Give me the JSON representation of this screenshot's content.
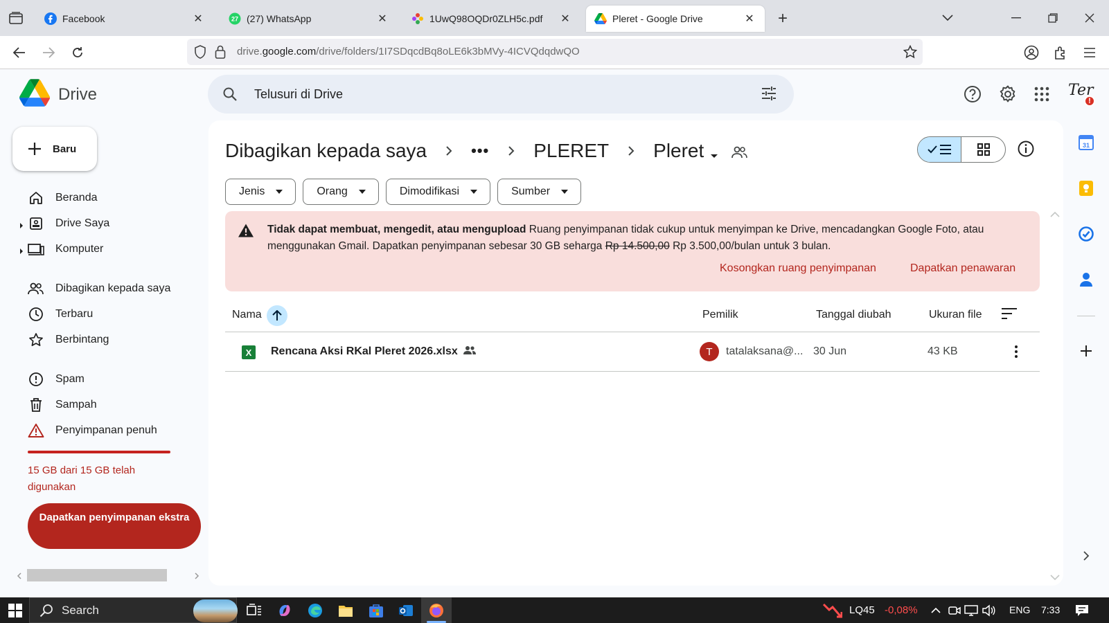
{
  "browser": {
    "tabs": [
      {
        "label": "Facebook",
        "icon": "facebook-icon",
        "active": false
      },
      {
        "label": "(27) WhatsApp",
        "icon": "whatsapp-icon",
        "badge": "27",
        "active": false
      },
      {
        "label": "1UwQ98OQDr0ZLH5c.pdf",
        "icon": "pdf-icon",
        "active": false
      },
      {
        "label": "Pleret - Google Drive",
        "icon": "google-drive-icon",
        "active": true
      }
    ],
    "url_prefix": "drive.",
    "url_host": "google.com",
    "url_path": "/drive/folders/1I7SDqcdBq8oLE6k3bMVy-4ICVQdqdwQO"
  },
  "drive": {
    "logo_text": "Drive",
    "search_placeholder": "Telusuri di Drive",
    "avatar_text": "Ter",
    "avatar_badge": "!",
    "new_button": "Baru",
    "sidebar": [
      {
        "label": "Beranda",
        "icon": "home-icon"
      },
      {
        "label": "Drive Saya",
        "icon": "my-drive-icon",
        "expandable": true
      },
      {
        "label": "Komputer",
        "icon": "computer-icon",
        "expandable": true
      },
      {
        "label": "Dibagikan kepada saya",
        "icon": "shared-with-me-icon"
      },
      {
        "label": "Terbaru",
        "icon": "clock-icon"
      },
      {
        "label": "Berbintang",
        "icon": "star-icon"
      },
      {
        "label": "Spam",
        "icon": "spam-icon"
      },
      {
        "label": "Sampah",
        "icon": "trash-icon"
      },
      {
        "label": "Penyimpanan penuh",
        "icon": "warning-icon"
      }
    ],
    "storage": {
      "used_fraction": 1.0,
      "text": "15 GB dari 15 GB telah digunakan",
      "button": "Dapatkan penyimpanan ekstra"
    },
    "breadcrumb": {
      "root": "Dibagikan kepada saya",
      "more": "•••",
      "parent": "PLERET",
      "current": "Pleret"
    },
    "filters": [
      "Jenis",
      "Orang",
      "Dimodifikasi",
      "Sumber"
    ],
    "alert": {
      "title": "Tidak dapat membuat, mengedit, atau mengupload",
      "body": " Ruang penyimpanan tidak cukup untuk menyimpan ke Drive, mencadangkan Google Foto, atau menggunakan Gmail. Dapatkan penyimpanan sebesar 30 GB seharga ",
      "old_price": "Rp 14.500,00",
      "new_price": " Rp 3.500,00/bulan untuk 3 bulan.",
      "action_free": "Kosongkan ruang penyimpanan",
      "action_offer": "Dapatkan penawaran"
    },
    "table": {
      "headers": {
        "name": "Nama",
        "owner": "Pemilik",
        "modified": "Tanggal diubah",
        "size": "Ukuran file"
      },
      "rows": [
        {
          "file_type_letter": "X",
          "name": "Rencana Aksi RKal Pleret 2026.xlsx",
          "shared": true,
          "owner_initial": "T",
          "owner": "tatalaksana@...",
          "modified": "30 Jun",
          "size": "43 KB"
        }
      ]
    }
  },
  "taskbar": {
    "search_label": "Search",
    "stock_name": "LQ45",
    "stock_change": "-0,08%",
    "language": "ENG",
    "time": "7:33"
  },
  "colors": {
    "accent_red": "#b3261e",
    "alert_bg": "#f9dedc",
    "selected_blue": "#c2e7ff",
    "excel_green": "#188038"
  }
}
